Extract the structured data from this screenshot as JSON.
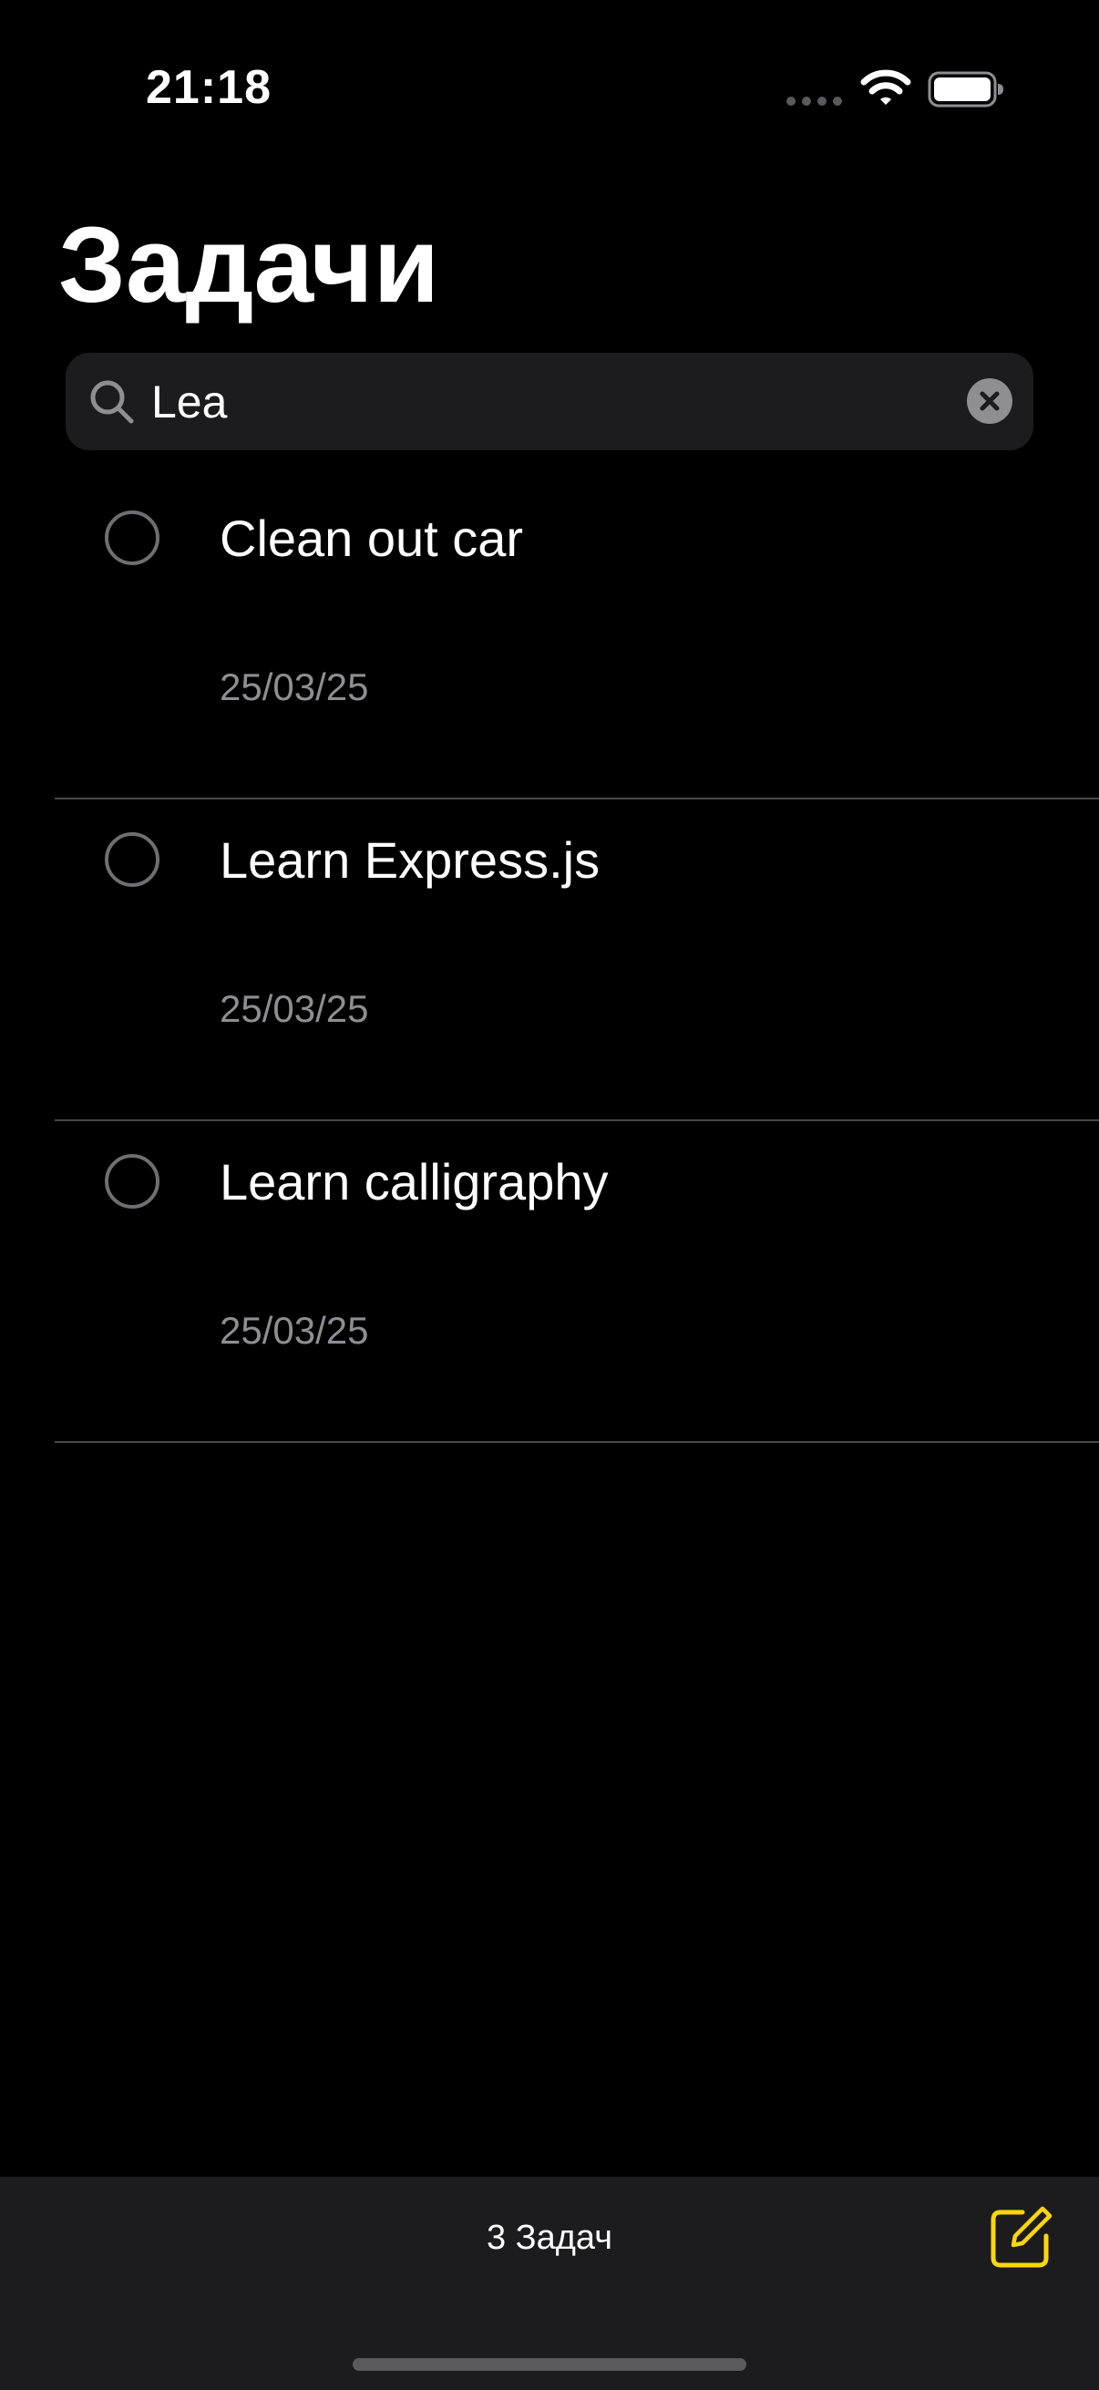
{
  "status_bar": {
    "time": "21:18"
  },
  "header": {
    "title": "Задачи"
  },
  "search": {
    "value": "Lea",
    "icon": "magnifyingglass",
    "clear_icon": "xmark.circle.fill"
  },
  "tasks": [
    {
      "title": "Clean out car",
      "date": "25/03/25",
      "completed": false
    },
    {
      "title": "Learn Express.js",
      "date": "25/03/25",
      "completed": false
    },
    {
      "title": "Learn calligraphy",
      "date": "25/03/25",
      "completed": false
    }
  ],
  "footer": {
    "task_count": "3 Задач",
    "compose_icon": "square.and.pencil"
  },
  "colors": {
    "accent": "#ffd60a",
    "background": "#000000",
    "bar_background": "#1c1c1e",
    "secondary_text": "#8e8e93"
  }
}
